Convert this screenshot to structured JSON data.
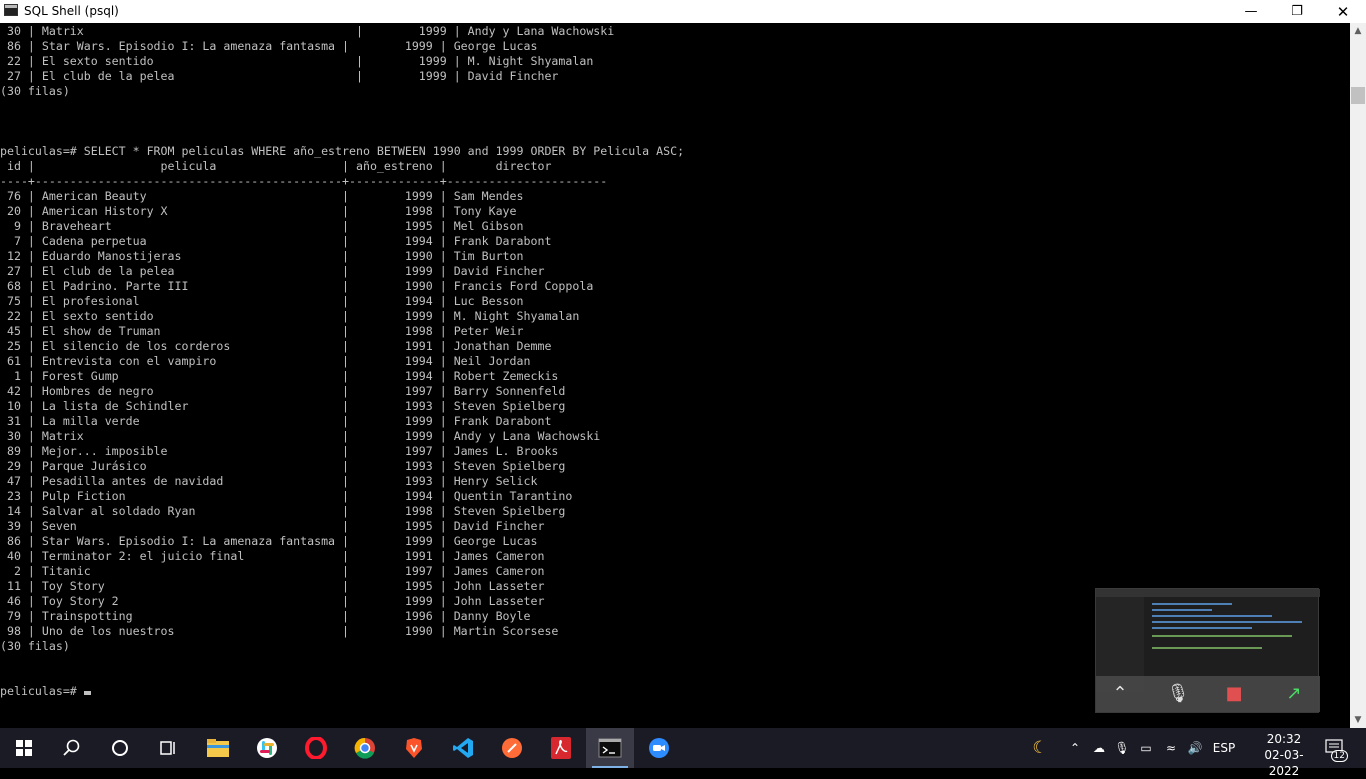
{
  "window": {
    "title": "SQL Shell (psql)"
  },
  "console": {
    "lines": [
      " 30 | Matrix                                       |        1999 | Andy y Lana Wachowski",
      " 86 | Star Wars. Episodio I: La amenaza fantasma |        1999 | George Lucas",
      " 22 | El sexto sentido                             |        1999 | M. Night Shyamalan",
      " 27 | El club de la pelea                          |        1999 | David Fincher",
      "(30 filas)",
      "",
      "",
      "",
      "peliculas=# SELECT * FROM peliculas WHERE año_estreno BETWEEN 1990 and 1999 ORDER BY Pelicula ASC;",
      " id |                  pelicula                  | año_estreno |       director",
      "----+--------------------------------------------+-------------+-----------------------",
      " 76 | American Beauty                            |        1999 | Sam Mendes",
      " 20 | American History X                         |        1998 | Tony Kaye",
      "  9 | Braveheart                                 |        1995 | Mel Gibson",
      "  7 | Cadena perpetua                            |        1994 | Frank Darabont",
      " 12 | Eduardo Manostijeras                       |        1990 | Tim Burton",
      " 27 | El club de la pelea                        |        1999 | David Fincher",
      " 68 | El Padrino. Parte III                      |        1990 | Francis Ford Coppola",
      " 75 | El profesional                             |        1994 | Luc Besson",
      " 22 | El sexto sentido                           |        1999 | M. Night Shyamalan",
      " 45 | El show de Truman                          |        1998 | Peter Weir",
      " 25 | El silencio de los corderos                |        1991 | Jonathan Demme",
      " 61 | Entrevista con el vampiro                  |        1994 | Neil Jordan",
      "  1 | Forest Gump                                |        1994 | Robert Zemeckis",
      " 42 | Hombres de negro                           |        1997 | Barry Sonnenfeld",
      " 10 | La lista de Schindler                      |        1993 | Steven Spielberg",
      " 31 | La milla verde                             |        1999 | Frank Darabont",
      " 30 | Matrix                                     |        1999 | Andy y Lana Wachowski",
      " 89 | Mejor... imposible                         |        1997 | James L. Brooks",
      " 29 | Parque Jurásico                            |        1993 | Steven Spielberg",
      " 47 | Pesadilla antes de navidad                 |        1993 | Henry Selick",
      " 23 | Pulp Fiction                               |        1994 | Quentin Tarantino",
      " 14 | Salvar al soldado Ryan                     |        1998 | Steven Spielberg",
      " 39 | Seven                                      |        1995 | David Fincher",
      " 86 | Star Wars. Episodio I: La amenaza fantasma |        1999 | George Lucas",
      " 40 | Terminator 2: el juicio final              |        1991 | James Cameron",
      "  2 | Titanic                                    |        1997 | James Cameron",
      " 11 | Toy Story                                  |        1995 | John Lasseter",
      " 46 | Toy Story 2                                |        1999 | John Lasseter",
      " 79 | Trainspotting                              |        1996 | Danny Boyle",
      " 98 | Uno de los nuestros                        |        1990 | Martin Scorsese",
      "(30 filas)",
      "",
      ""
    ],
    "prompt": "peliculas=# "
  },
  "taskbar": {
    "language": "ESP",
    "time": "20:32",
    "date": "02-03-2022",
    "notifications": "12",
    "apps": [
      "start-icon",
      "search-icon",
      "cortana-icon",
      "task-view-icon",
      "file-explorer-icon",
      "slack-icon",
      "opera-icon",
      "chrome-icon",
      "brave-icon",
      "vscode-icon",
      "postman-icon",
      "acrobat-icon",
      "terminal-icon",
      "zoom-icon"
    ]
  },
  "colors": {
    "console_bg": "#000000",
    "console_fg": "#c0c0c0",
    "taskbar_bg": "#1b1b25"
  }
}
